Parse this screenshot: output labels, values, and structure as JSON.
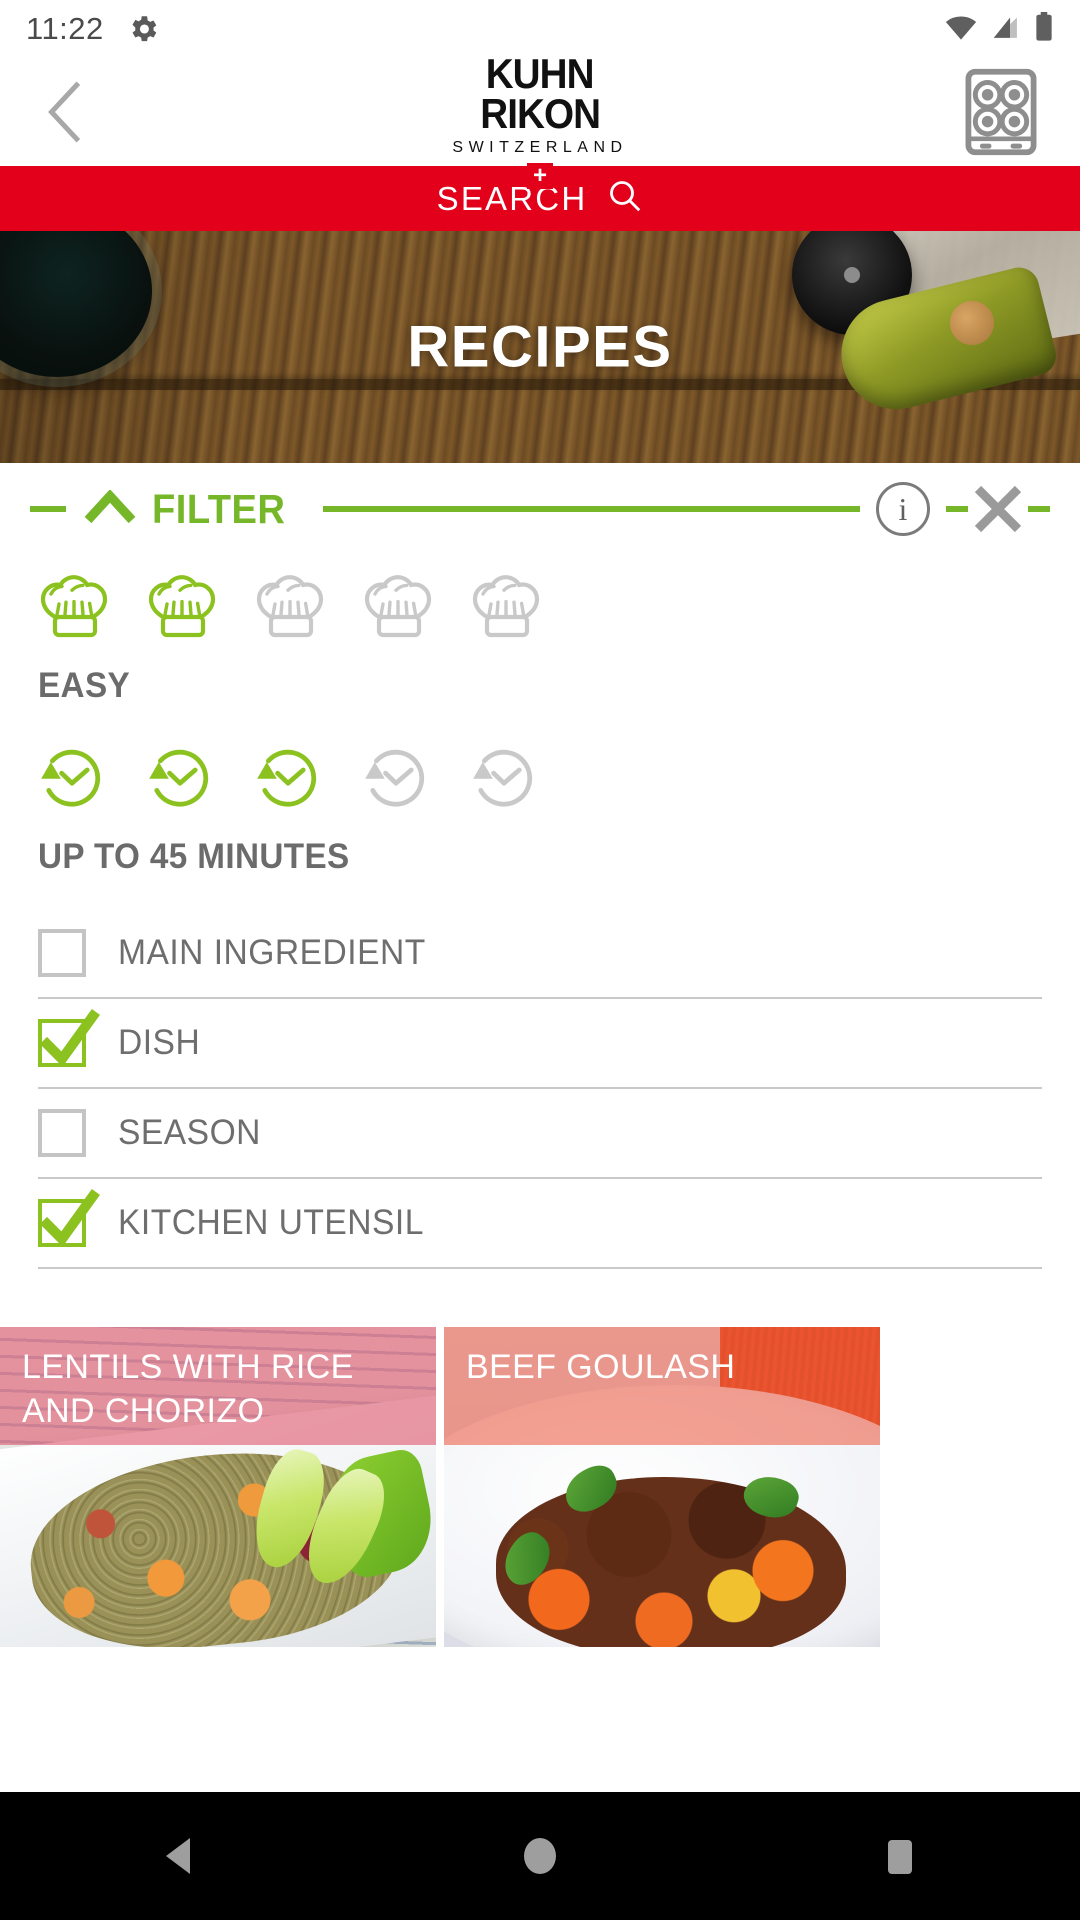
{
  "status_bar": {
    "time": "11:22",
    "icons": [
      "gear-icon",
      "wifi-icon",
      "signal-icon",
      "battery-icon"
    ]
  },
  "app_bar": {
    "back_icon": "chevron-left-icon",
    "logo": {
      "line1": "KUHN",
      "line2": "RIKON",
      "subtitle": "SWITZERLAND",
      "cross_symbol": "+",
      "cross_color": "#e2001a"
    },
    "hob_icon": "cooktop-icon"
  },
  "search": {
    "label": "SEARCH",
    "icon": "search-icon",
    "background": "#e2001a"
  },
  "hero": {
    "title": "RECIPES"
  },
  "filter": {
    "label": "FILTER",
    "collapse_icon": "chevron-up-icon",
    "info_icon": "info-icon",
    "info_glyph": "i",
    "close_icon": "close-icon",
    "accent_color": "#76b72a",
    "difficulty": {
      "icon": "chef-hat-icon",
      "total": 5,
      "selected": 2,
      "label": "EASY"
    },
    "duration": {
      "icon": "clock-arrow-icon",
      "total": 5,
      "selected": 3,
      "label": "UP TO 45 MINUTES"
    },
    "checkboxes": [
      {
        "label": "MAIN INGREDIENT",
        "checked": false
      },
      {
        "label": "DISH",
        "checked": true
      },
      {
        "label": "SEASON",
        "checked": false
      },
      {
        "label": "KITCHEN UTENSIL",
        "checked": true
      }
    ]
  },
  "recipes": [
    {
      "title": "LENTILS WITH RICE AND CHORIZO",
      "tint": "#de5a70"
    },
    {
      "title": "BEEF GOULASH",
      "tint": "#ec563c"
    }
  ],
  "nav_bar": {
    "back_icon": "triangle-back-icon",
    "home_icon": "circle-home-icon",
    "recents_icon": "square-recents-icon"
  }
}
